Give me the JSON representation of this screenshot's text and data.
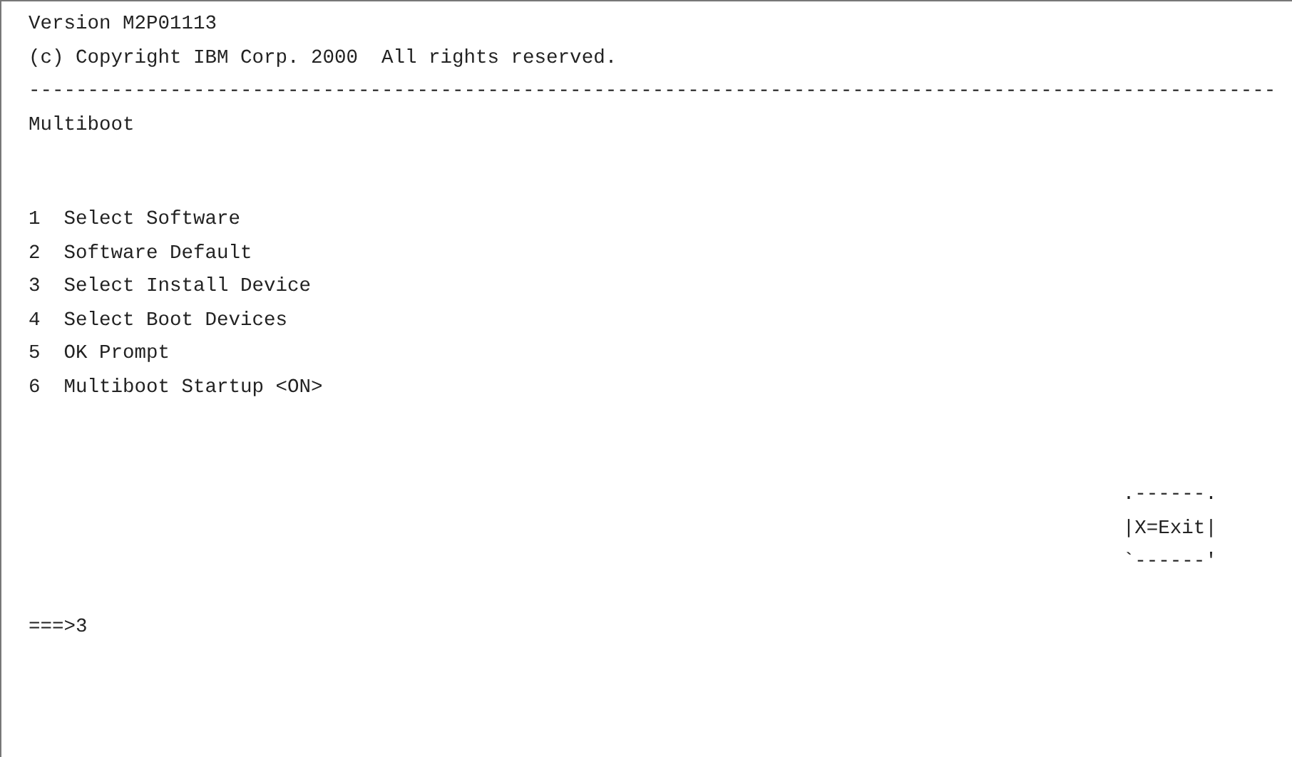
{
  "header": [
    "Version M2P01113",
    "(c) Copyright IBM Corp. 2000  All rights reserved."
  ],
  "separator": "----------------------------------------------------------------------------------------------------------",
  "title": "Multiboot",
  "menu": [
    {
      "number": "1",
      "label": "Select Software"
    },
    {
      "number": "2",
      "label": "Software Default"
    },
    {
      "number": "3",
      "label": "Select Install Device"
    },
    {
      "number": "4",
      "label": "Select Boot Devices"
    },
    {
      "number": "5",
      "label": "OK Prompt"
    },
    {
      "number": "6",
      "label": "Multiboot Startup <ON>"
    }
  ],
  "exit_box": [
    ".------.",
    "|X=Exit|",
    "`------'"
  ],
  "prompt": "===>3"
}
